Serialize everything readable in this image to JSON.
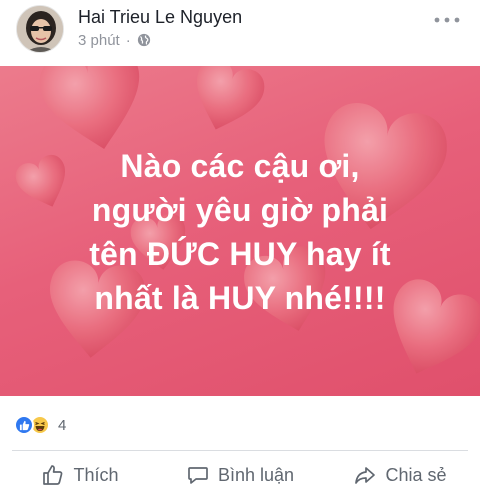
{
  "post": {
    "author": "Hai Trieu Le Nguyen",
    "time": "3 phút",
    "separator": "·",
    "privacy_icon": "globe-icon",
    "more_icon": "more-dots-icon"
  },
  "image": {
    "lines": [
      "Nào các cậu ơi,",
      "người yêu giờ phải",
      "tên ĐỨC HUY hay ít",
      "nhất là HUY nhé!!!!"
    ],
    "background_color": "#e7607a",
    "text_color": "#ffffff"
  },
  "reactions": {
    "icons": [
      "like-icon",
      "haha-icon"
    ],
    "count": "4",
    "like_color": "#2f78f0",
    "haha_color": "#f7c84a"
  },
  "actions": {
    "like": "Thích",
    "comment": "Bình luận",
    "share": "Chia sẻ"
  }
}
